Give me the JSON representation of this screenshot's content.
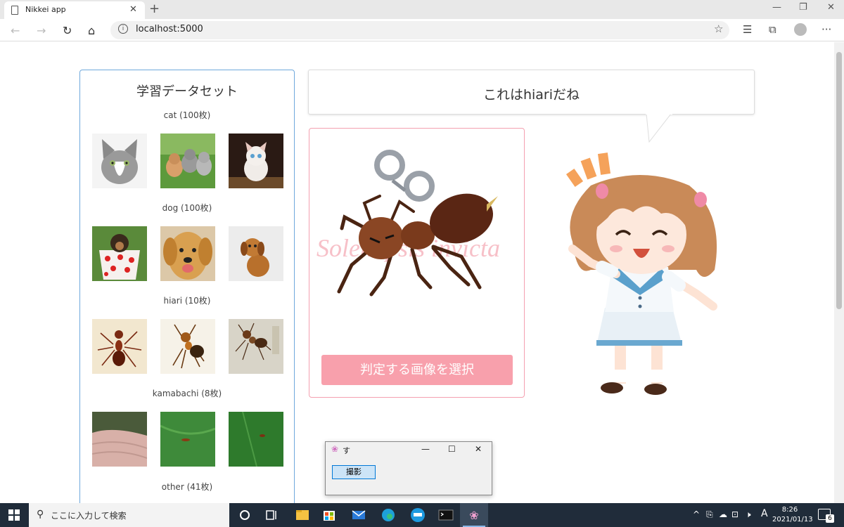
{
  "browser": {
    "tab_title": "Nikkei app",
    "url": "localhost:5000"
  },
  "dataset": {
    "title": "学習データセット",
    "categories": [
      {
        "label": "cat (100枚)"
      },
      {
        "label": "dog (100枚)"
      },
      {
        "label": "hiari (10枚)"
      },
      {
        "label": "kamabachi (8枚)"
      },
      {
        "label": "other (41枚)"
      }
    ]
  },
  "result": {
    "speech_text": "これはhiariだね",
    "select_button": "判定する画像を選択",
    "watermark": "Solenopsis invicta"
  },
  "mini_window": {
    "title": "す",
    "shoot_button": "撮影"
  },
  "taskbar": {
    "search_placeholder": "ここに入力して検索",
    "ime": "A",
    "time": "8:26",
    "date": "2021/01/13",
    "notification_count": "6"
  },
  "colors": {
    "panel_border": "#6fa8dc",
    "judge_border": "#f4a0b0",
    "accent_pink": "#f8a0ac",
    "taskbar": "#202c3a"
  }
}
